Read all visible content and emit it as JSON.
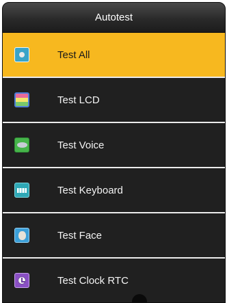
{
  "window": {
    "title": "Autotest"
  },
  "menu": {
    "items": [
      {
        "label": "Test All",
        "icon": "disc-icon",
        "selected": true
      },
      {
        "label": "Test LCD",
        "icon": "lcd-icon",
        "selected": false
      },
      {
        "label": "Test Voice",
        "icon": "speaker-icon",
        "selected": false
      },
      {
        "label": "Test Keyboard",
        "icon": "keyboard-icon",
        "selected": false
      },
      {
        "label": "Test Face",
        "icon": "face-icon",
        "selected": false
      },
      {
        "label": "Test Clock RTC",
        "icon": "clock-icon",
        "selected": false
      }
    ]
  },
  "colors": {
    "background": "#1f1f1f",
    "highlight": "#f7b81f",
    "separator": "#ececec",
    "text": "#f4f4f4"
  }
}
